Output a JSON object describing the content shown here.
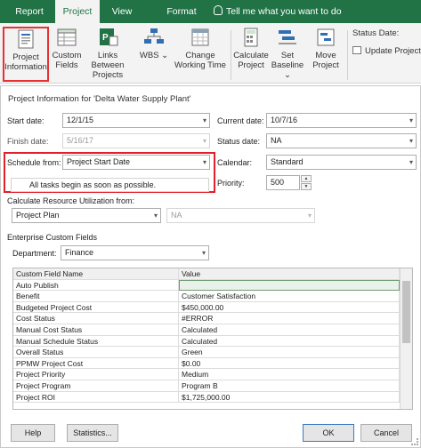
{
  "ribbon": {
    "tabs": [
      {
        "label": "Report"
      },
      {
        "label": "Project"
      },
      {
        "label": "View"
      },
      {
        "label": "Format"
      }
    ],
    "tell_me": "Tell me what you want to do",
    "buttons": {
      "project_information": [
        "Project",
        "Information"
      ],
      "custom_fields": [
        "Custom",
        "Fields"
      ],
      "links_between_projects": [
        "Links Between",
        "Projects"
      ],
      "wbs": [
        "WBS",
        ""
      ],
      "change_working_time": [
        "Change",
        "Working Time"
      ],
      "calculate_project": [
        "Calculate",
        "Project"
      ],
      "set_baseline": [
        "Set",
        "Baseline"
      ],
      "move_project": [
        "Move",
        "Project"
      ]
    },
    "status_date_label": "Status Date:",
    "update_project": "Update Project",
    "accent_color": "#217346"
  },
  "dialog": {
    "title": "Project Information for 'Delta Water Supply Plant'",
    "start_date": {
      "label": "Start date:",
      "value": "12/1/15"
    },
    "finish_date": {
      "label": "Finish date:",
      "value": "5/16/17"
    },
    "schedule_from": {
      "label": "Schedule from:",
      "value": "Project Start Date"
    },
    "info_message": "All tasks begin as soon as possible.",
    "current_date": {
      "label": "Current date:",
      "value": "10/7/16"
    },
    "status_date": {
      "label": "Status date:",
      "value": "NA"
    },
    "calendar": {
      "label": "Calendar:",
      "value": "Standard"
    },
    "priority": {
      "label": "Priority:",
      "value": "500"
    },
    "calc_resource_label": "Calculate Resource Utilization from:",
    "calc_resource": {
      "value": "Project Plan",
      "secondary": "NA"
    },
    "enterprise_label": "Enterprise Custom Fields",
    "department": {
      "label": "Department:",
      "value": "Finance"
    },
    "grid": {
      "headers": [
        "Custom Field Name",
        "Value"
      ],
      "rows": [
        [
          "Auto Publish",
          ""
        ],
        [
          "Benefit",
          "Customer Satisfaction"
        ],
        [
          "Budgeted Project Cost",
          "$450,000.00"
        ],
        [
          "Cost Status",
          "#ERROR"
        ],
        [
          "Manual Cost Status",
          "Calculated"
        ],
        [
          "Manual Schedule Status",
          "Calculated"
        ],
        [
          "Overall Status",
          "Green"
        ],
        [
          "PPMW Project Cost",
          "$0.00"
        ],
        [
          "Project Priority",
          "Medium"
        ],
        [
          "Project Program",
          "Program B"
        ],
        [
          "Project ROI",
          "$1,725,000.00"
        ]
      ]
    },
    "buttons": {
      "help": "Help",
      "statistics": "Statistics...",
      "ok": "OK",
      "cancel": "Cancel"
    },
    "highlight_color": "#e0202a"
  }
}
